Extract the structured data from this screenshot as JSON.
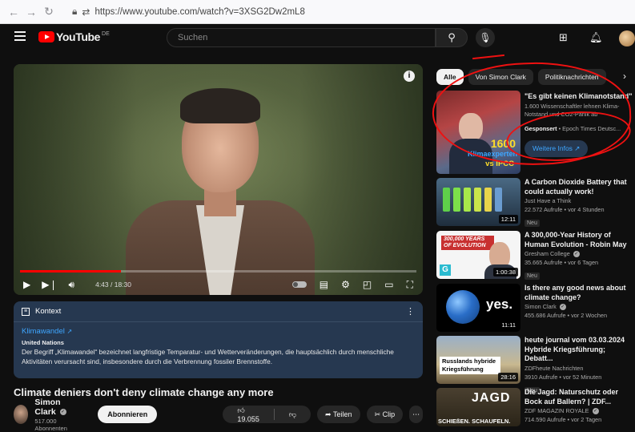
{
  "browser": {
    "url": "https://www.youtube.com/watch?v=3XSG2Dw2mL8"
  },
  "header": {
    "logo_text": "YouTube",
    "logo_region": "DE",
    "search_placeholder": "Suchen"
  },
  "player": {
    "time": "4:43 / 18:30",
    "progress_fraction": 0.255
  },
  "context": {
    "title": "Kontext",
    "link": "Klimawandel",
    "source": "United Nations",
    "text": "Der Begriff „Klimawandel“ bezeichnet langfristige Temparatur- und Wetterveränderungen, die hauptsächlich durch menschliche Aktivitäten verursacht sind, insbesondere durch die Verbrennung fossiler Brennstoffe."
  },
  "video": {
    "title": "Climate deniers don't deny climate change any more",
    "channel": "Simon Clark",
    "subscribers": "517.000 Abonnenten",
    "subscribe_label": "Abonnieren",
    "likes": "19.055",
    "share_label": "Teilen",
    "clip_label": "Clip"
  },
  "chips": [
    "Alle",
    "Von Simon Clark",
    "Politiknachrichten"
  ],
  "ad": {
    "title": "\"Es gibt keinen Klimanotstand\"",
    "desc": "1.600 Wissenschaftler lehnen Klima-Notstand und CO2-Panik ab",
    "sponsored": "Gesponsert",
    "advertiser": "Epoch Times Deutsc...",
    "cta": "Weitere Infos",
    "thumb_number": "1600",
    "thumb_line1": "Klimaexperten",
    "thumb_line2": "vs IPCC"
  },
  "recommendations": [
    {
      "title": "A Carbon Dioxide Battery that could actually work!",
      "channel": "Just Have a Think",
      "meta": "22.572 Aufrufe • vor 4 Stunden",
      "badge": "Neu",
      "duration": "12:11"
    },
    {
      "title": "A 300,000-Year History of Human Evolution - Robin May",
      "channel": "Gresham College",
      "meta": "35.665 Aufrufe • vor 6 Tagen",
      "badge": "Neu",
      "duration": "1:00:38",
      "thumb_text": "300,000 YEARS OF EVOLUTION"
    },
    {
      "title": "Is there any good news about climate change?",
      "channel": "Simon Clark",
      "meta": "455.686 Aufrufe • vor 2 Wochen",
      "badge": "",
      "duration": "11:11",
      "thumb_text": "yes."
    },
    {
      "title": "heute journal vom 03.03.2024 Hybride Kriegsführung; Debatt...",
      "channel": "ZDFheute Nachrichten",
      "meta": "3910 Aufrufe • vor 52 Minuten",
      "badge": "Neu",
      "duration": "28:16",
      "thumb_text": "Russlands hybride Kriegsführung"
    },
    {
      "title": "Die Jagd: Naturschutz oder Bock auf Ballern? | ZDF...",
      "channel": "ZDF MAGAZIN ROYALE",
      "meta": "714.590 Aufrufe • vor 2 Tagen",
      "badge": "",
      "duration": "",
      "thumb_text": "JAGD",
      "thumb_sub": "SCHIEßEN. SCHAUFELN."
    }
  ],
  "colors": {
    "brand_red": "#ff0000",
    "background": "#0f0f0f",
    "link_blue": "#3ea6ff",
    "annotation_red": "#ee1111"
  }
}
